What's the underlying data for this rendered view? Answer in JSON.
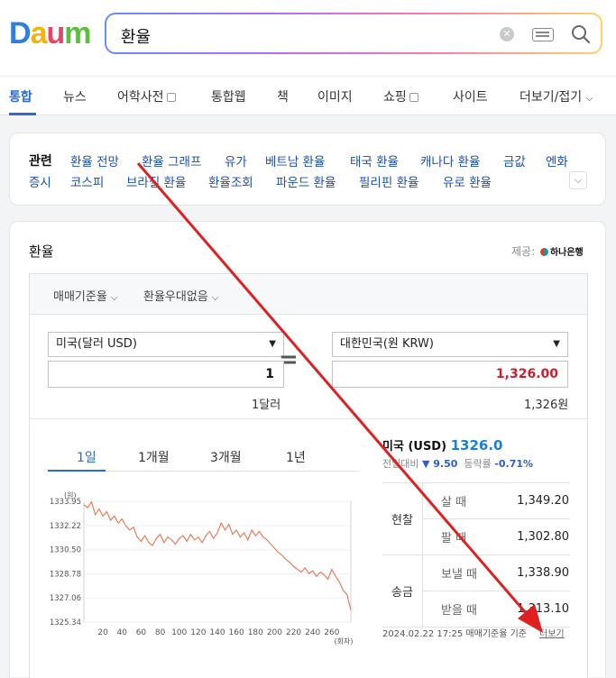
{
  "logo": {
    "letters": [
      "D",
      "a",
      "u",
      "m"
    ],
    "colors": [
      "#2f7de1",
      "#f4b400",
      "#e9436a",
      "#5abf3a"
    ]
  },
  "search": {
    "query": "환율"
  },
  "tabs": [
    {
      "label": "통합",
      "active": true,
      "ext": false
    },
    {
      "label": "뉴스",
      "ext": false
    },
    {
      "label": "어학사전",
      "ext": true
    },
    {
      "label": "통합웹",
      "ext": false
    },
    {
      "label": "책",
      "ext": false
    },
    {
      "label": "이미지",
      "ext": false
    },
    {
      "label": "쇼핑",
      "ext": true
    },
    {
      "label": "사이트",
      "ext": false
    },
    {
      "label": "더보기/접기",
      "ext": false
    }
  ],
  "related": {
    "title": "관련",
    "row1": [
      "환율 전망",
      "환율 그래프",
      "유가",
      "베트남 환율",
      "태국 환율",
      "캐나다 환율",
      "금값",
      "엔화"
    ],
    "row2": [
      "증시",
      "코스피",
      "브라질 환율",
      "환율조회",
      "파운드 환율",
      "필리핀 환율",
      "유로 환율"
    ]
  },
  "exchange": {
    "title": "환율",
    "provider_label": "제공:",
    "provider": "하나은행",
    "option1": "매매기준율",
    "option2": "환율우대없음",
    "from_currency": "미국(달러 USD)",
    "to_currency": "대한민국(원 KRW)",
    "from_amount": "1",
    "to_amount": "1,326.00",
    "from_unit": "1달러",
    "to_unit": "1,326원",
    "periods": [
      "1일",
      "1개월",
      "3개월",
      "1년"
    ],
    "usd_label": "미국 (USD)",
    "usd_rate": "1326.0",
    "prev_label": "전일대비",
    "change": "▼ 9.50",
    "rate_label": "등락률",
    "rate": "-0.71%",
    "cash_label": "현찰",
    "transfer_label": "송금",
    "rows": [
      {
        "label": "살 때",
        "value": "1,349.20"
      },
      {
        "label": "팔 때",
        "value": "1,302.80"
      },
      {
        "label": "보낼 때",
        "value": "1,338.90"
      },
      {
        "label": "받을 때",
        "value": "1,313.10"
      }
    ],
    "footer": "2024.02.22 17:25  매매기준율 기준",
    "more": "더보기"
  },
  "colors": {
    "accent": "#2b6bd6",
    "amount_red": "#c8202f",
    "chart_line": "#e67e5a",
    "arrow": "#e02020"
  },
  "chart_data": {
    "type": "line",
    "ylabel": "(원)",
    "xlabel": "(회차)",
    "yticks": [
      "1333.95",
      "1332.22",
      "1330.50",
      "1328.78",
      "1327.06",
      "1325.34"
    ],
    "ylim": [
      1325.34,
      1333.95
    ],
    "xticks": [
      20,
      40,
      60,
      80,
      100,
      120,
      140,
      160,
      180,
      200,
      220,
      240,
      260
    ],
    "xlim": [
      0,
      280
    ],
    "series": [
      {
        "x": [
          0,
          4,
          8,
          12,
          16,
          20,
          24,
          28,
          32,
          36,
          40,
          44,
          48,
          52,
          56,
          60,
          64,
          68,
          72,
          76,
          80,
          84,
          88,
          92,
          96,
          100,
          104,
          108,
          112,
          116,
          120,
          124,
          128,
          132,
          136,
          140,
          144,
          148,
          152,
          156,
          160,
          164,
          168,
          172,
          176,
          180,
          184,
          188,
          192,
          196,
          200,
          204,
          208,
          212,
          216,
          220,
          224,
          228,
          232,
          236,
          240,
          244,
          248,
          252,
          256,
          260,
          264,
          268,
          272,
          276,
          280
        ],
        "y": [
          1333.7,
          1333.5,
          1333.9,
          1333.0,
          1333.4,
          1332.9,
          1333.2,
          1332.6,
          1332.9,
          1332.4,
          1332.7,
          1332.2,
          1331.9,
          1332.1,
          1331.4,
          1331.1,
          1331.5,
          1331.0,
          1330.8,
          1331.3,
          1331.6,
          1331.0,
          1331.4,
          1331.2,
          1330.9,
          1331.3,
          1331.5,
          1331.1,
          1331.6,
          1331.2,
          1331.4,
          1331.0,
          1331.5,
          1331.8,
          1331.3,
          1331.7,
          1332.4,
          1331.9,
          1332.3,
          1331.6,
          1331.9,
          1331.4,
          1331.7,
          1331.2,
          1331.9,
          1331.5,
          1331.8,
          1331.4,
          1331.2,
          1330.9,
          1330.6,
          1330.3,
          1330.1,
          1329.8,
          1329.6,
          1329.3,
          1329.1,
          1328.9,
          1329.2,
          1328.8,
          1329.0,
          1328.6,
          1328.9,
          1328.7,
          1328.4,
          1329.1,
          1328.6,
          1328.2,
          1327.6,
          1327.3,
          1326.2
        ]
      }
    ]
  }
}
